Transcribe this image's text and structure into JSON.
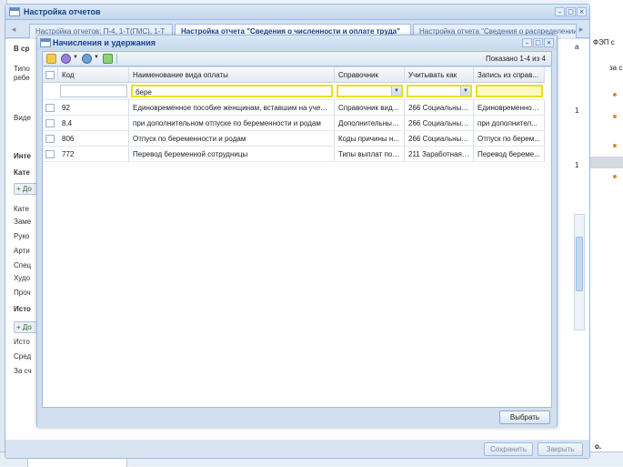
{
  "outer_window": {
    "title": "Настройка отчетов",
    "tabs": [
      "Настройка отчетов: П-4, 1-Т(ГМС), 1-Т",
      "Настройка отчета \"Сведения о численности и оплате труда\"",
      "Настройка отчета \"Сведения о распределении"
    ],
    "left_fragments": [
      "В ср",
      "Типо",
      "ребе",
      "Виде",
      "Инте",
      "Кате",
      "До",
      "Кате",
      "Заме",
      "Руко",
      "Арти",
      "Спец",
      "Худо",
      "Проч",
      "Исто",
      "До",
      "Исто",
      "Сред",
      "За сч"
    ],
    "right_fragments": [
      "ФЭП с",
      "за с",
      "о.",
      "а",
      "1",
      "1"
    ],
    "save_label": "Сохранить",
    "close_label": "Закрыть"
  },
  "modal": {
    "title": "Начисления и удержания",
    "paging_text": "Показано 1-4 из 4",
    "columns": [
      "Код",
      "Наименование вида оплаты",
      "Справочник",
      "Учитывать как",
      "Запись из справ..."
    ],
    "filter_name_value": "бере",
    "rows": [
      [
        "92",
        "Единовременное пособие женщинам, вставшим на учет в...",
        "Справочник вид...",
        "266 Социальные ...",
        "Единовременное..."
      ],
      [
        "8.4",
        "при дополнительном отпуске по беременности и родам",
        "Дополнительные...",
        "266 Социальные ...",
        "при дополнител..."
      ],
      [
        "806",
        "Отпуск по беременности и родам",
        "Коды причины н...",
        "266 Социальные ...",
        "Отпуск по берем..."
      ],
      [
        "772",
        "Перевод беременной сотрудницы",
        "Типы выплат по ...",
        "211 Заработная ...",
        "Перевод береме..."
      ]
    ],
    "select_label": "Выбрать"
  },
  "colors": {
    "title_text": "#15428b",
    "border": "#99bbe8",
    "filter_highlight": "#e6e21a",
    "filter_fill": "#fbfac2"
  }
}
